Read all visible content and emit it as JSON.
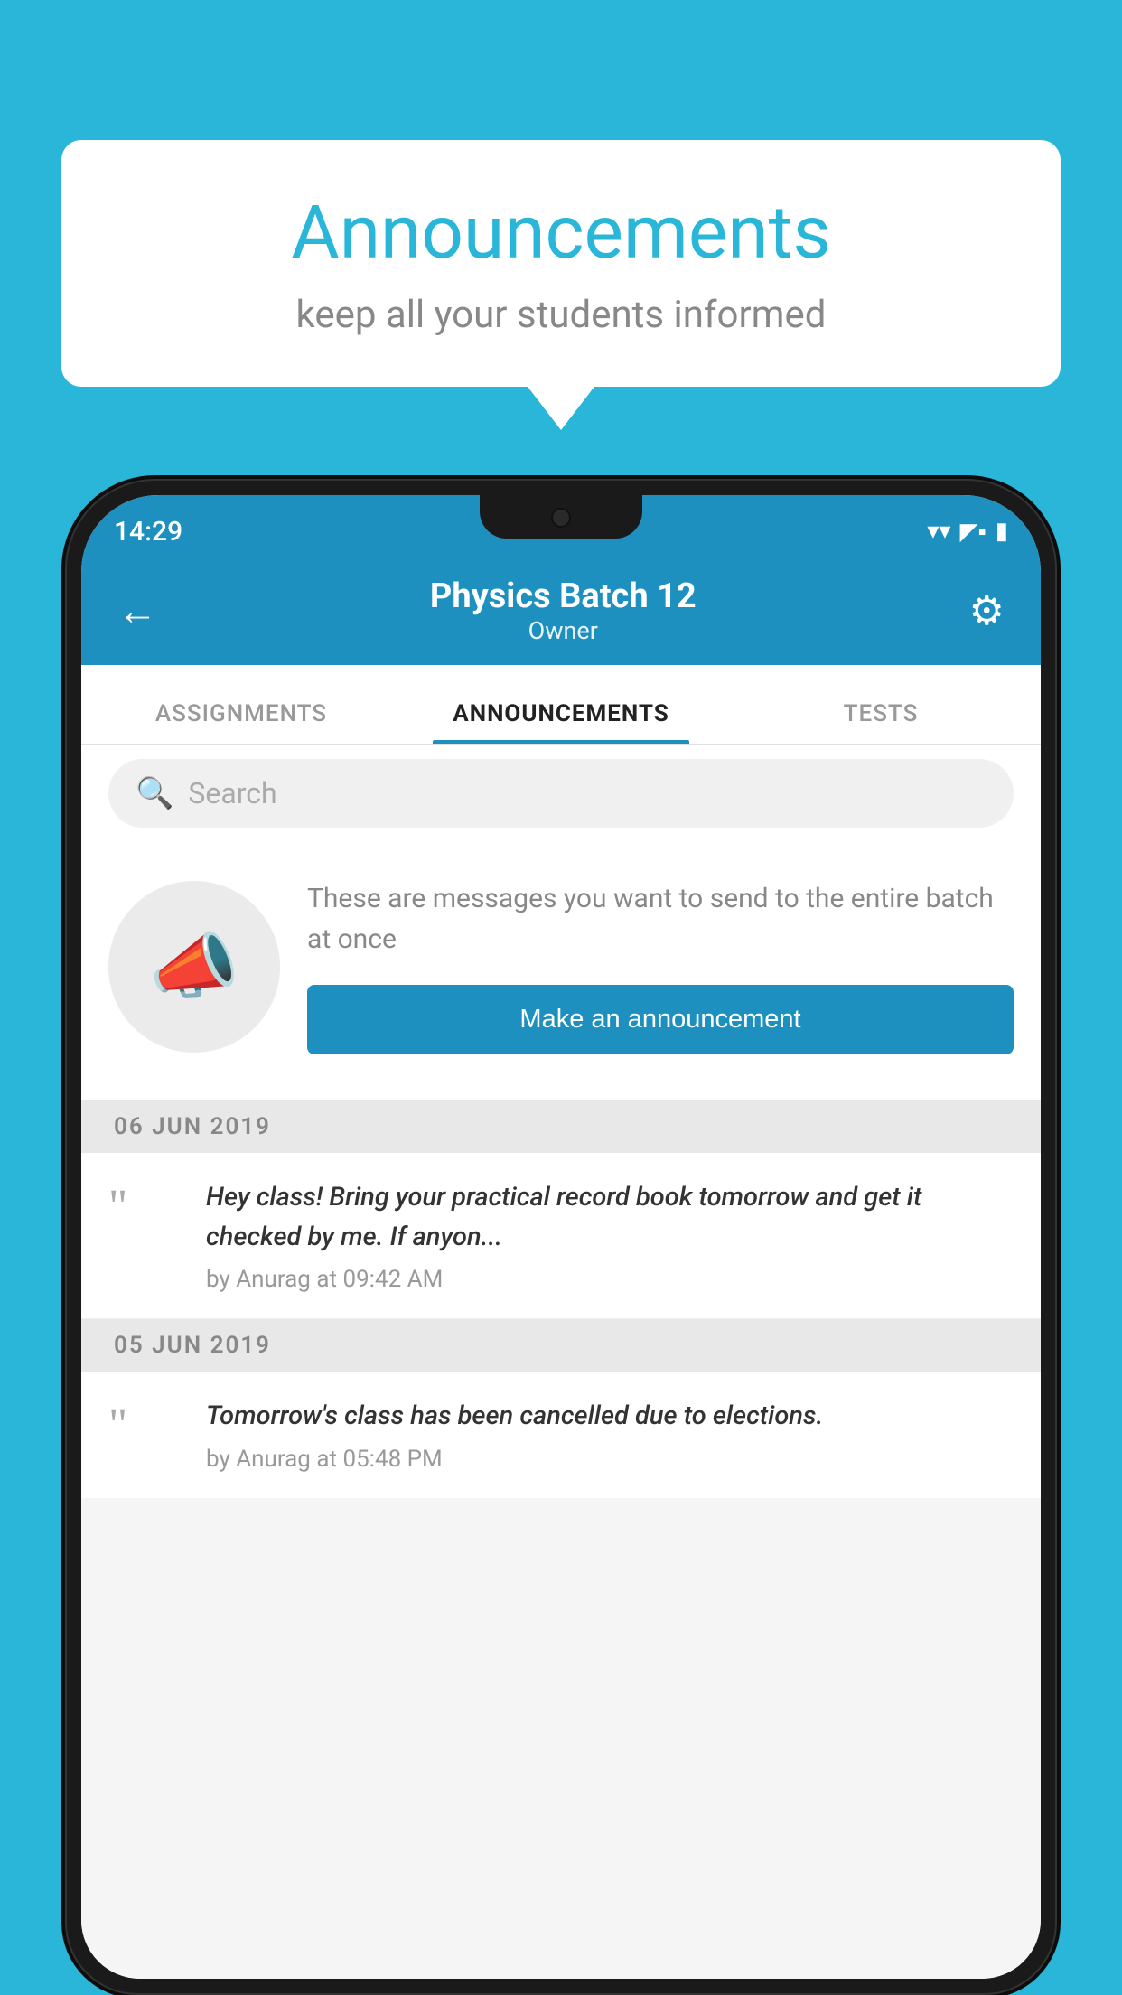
{
  "background_color": "#29b6d8",
  "speech_bubble": {
    "title": "Announcements",
    "subtitle": "keep all your students informed"
  },
  "status_bar": {
    "time": "14:29",
    "wifi": "▾",
    "signal": "▴",
    "battery": "▪"
  },
  "header": {
    "title": "Physics Batch 12",
    "subtitle": "Owner",
    "back_label": "←",
    "settings_label": "⚙"
  },
  "tabs": [
    {
      "label": "ASSIGNMENTS",
      "active": false
    },
    {
      "label": "ANNOUNCEMENTS",
      "active": true
    },
    {
      "label": "TESTS",
      "active": false
    }
  ],
  "search": {
    "placeholder": "Search"
  },
  "announcement_prompt": {
    "description_text": "These are messages you want to send to the entire batch at once",
    "button_label": "Make an announcement"
  },
  "announcements": [
    {
      "date": "06  JUN  2019",
      "text": "Hey class! Bring your practical record book tomorrow and get it checked by me. If anyon...",
      "meta": "by Anurag at 09:42 AM"
    },
    {
      "date": "05  JUN  2019",
      "text": "Tomorrow's class has been cancelled due to elections.",
      "meta": "by Anurag at 05:48 PM"
    }
  ],
  "icons": {
    "back": "←",
    "settings": "⚙",
    "search": "🔍",
    "megaphone": "📣",
    "quote": "““"
  }
}
